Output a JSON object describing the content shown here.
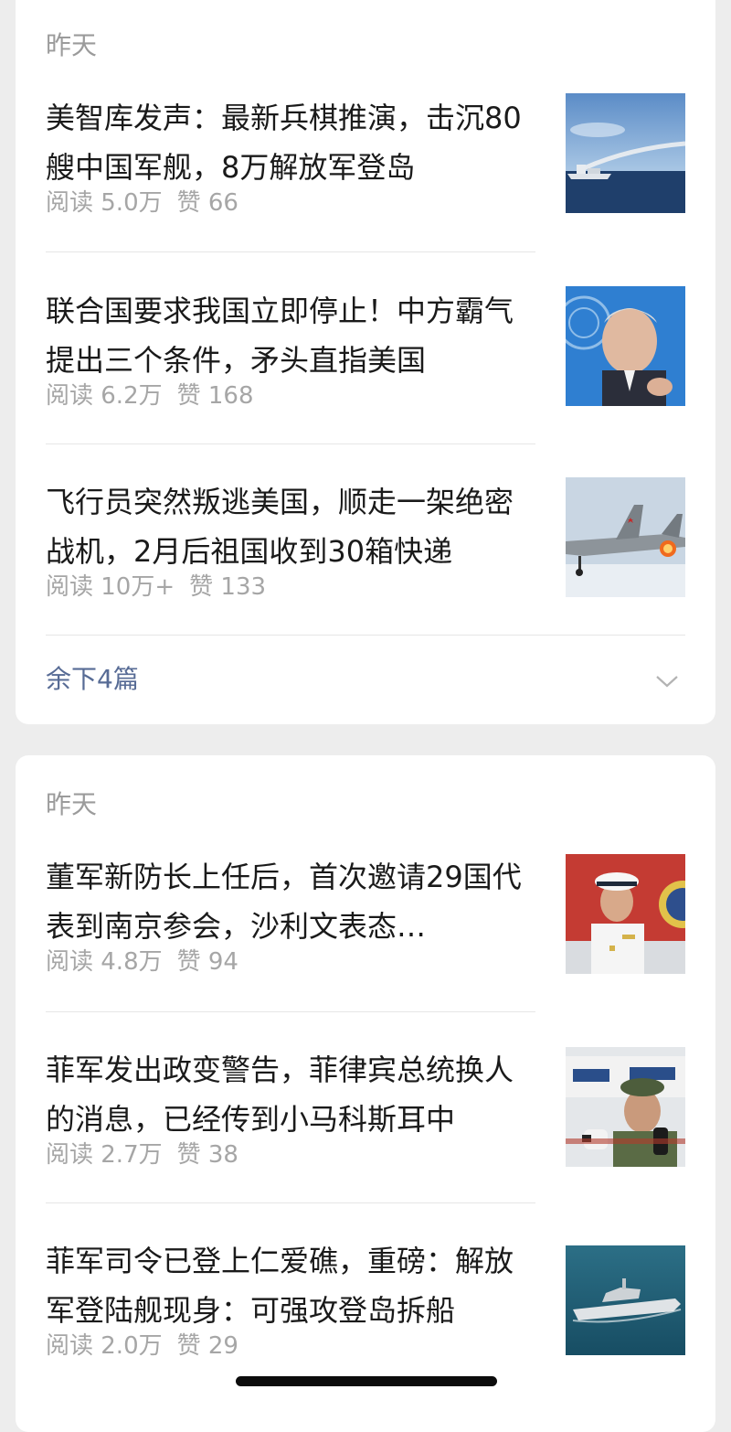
{
  "groups": [
    {
      "date": "昨天",
      "articles": [
        {
          "title": "美智库发声：最新兵棋推演，击沉80艘中国军舰，8万解放军登岛",
          "reads": "阅读 5.0万",
          "likes": "赞 66",
          "image": "warship-missile-launch"
        },
        {
          "title": "联合国要求我国立即停止！中方霸气提出三个条件，矛头直指美国",
          "reads": "阅读 6.2万",
          "likes": "赞 168",
          "image": "un-official-speaking"
        },
        {
          "title": "飞行员突然叛逃美国，顺走一架绝密战机，2月后祖国收到30箱快递",
          "reads": "阅读 10万+",
          "likes": "赞 133",
          "image": "fighter-jet"
        }
      ],
      "more_label": "余下4篇",
      "more_icon": "chevron-down-icon"
    },
    {
      "date": "昨天",
      "articles": [
        {
          "title": "董军新防长上任后，首次邀请29国代表到南京参会，沙利文表态…",
          "reads": "阅读 4.8万",
          "likes": "赞 94",
          "image": "naval-officer-white-uniform"
        },
        {
          "title": "菲军发出政变警告，菲律宾总统换人的消息，已经传到小马科斯耳中",
          "reads": "阅读 2.7万",
          "likes": "赞 38",
          "image": "general-with-microphones"
        },
        {
          "title": "菲军司令已登上仁爱礁，重磅：解放军登陆舰现身：可强攻登岛拆船",
          "reads": "阅读 2.0万",
          "likes": "赞 29",
          "image": "landing-ship-at-sea"
        }
      ]
    }
  ],
  "colors": {
    "background": "#ededed",
    "card": "#ffffff",
    "title": "#1a1a1a",
    "meta": "#a6a6a6",
    "date": "#9b9b9b",
    "link": "#576b95"
  }
}
